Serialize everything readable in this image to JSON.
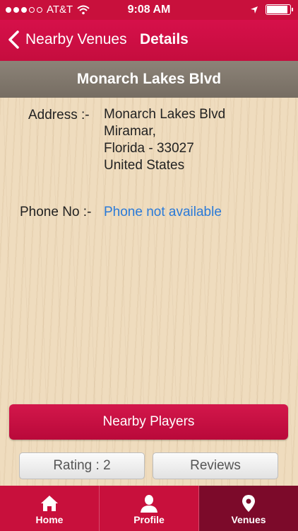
{
  "status": {
    "carrier": "AT&T",
    "time": "9:08 AM"
  },
  "nav": {
    "back_label": "Nearby Venues",
    "title": "Details"
  },
  "venue": {
    "name": "Monarch Lakes Blvd",
    "address_label": "Address :-",
    "address_lines": [
      "Monarch Lakes Blvd",
      "Miramar,",
      "Florida - 33027",
      "United States"
    ],
    "phone_label": "Phone No :-",
    "phone_value": "Phone not available"
  },
  "actions": {
    "nearby_players": "Nearby Players",
    "rating": "Rating : 2",
    "reviews": "Reviews"
  },
  "tabs": [
    {
      "label": "Home",
      "icon": "home-icon"
    },
    {
      "label": "Profile",
      "icon": "profile-icon"
    },
    {
      "label": "Venues",
      "icon": "location-pin-icon",
      "active": true
    }
  ],
  "colors": {
    "brand": "#c8103c",
    "active_tab": "#7c0a2a",
    "link": "#2a7ad8"
  }
}
